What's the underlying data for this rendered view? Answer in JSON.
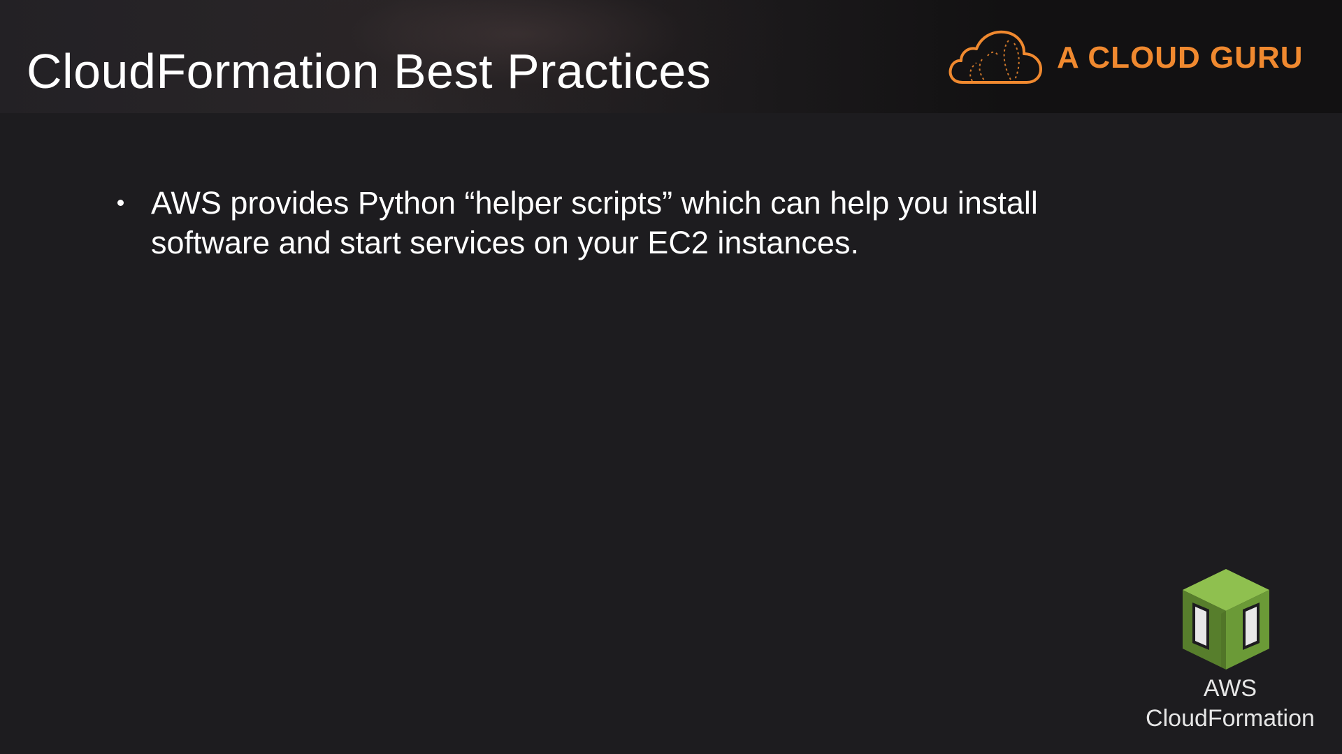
{
  "header": {
    "title": "CloudFormation Best Practices",
    "brand": {
      "name": "A CLOUD GURU",
      "logo_icon": "cloud-icon",
      "color": "#f0892f"
    }
  },
  "content": {
    "bullets": [
      {
        "text": "AWS provides Python “helper scripts” which can help you install software and start services on your EC2 instances."
      }
    ]
  },
  "service_badge": {
    "icon": "aws-cloudformation-icon",
    "color": "#6b9a37",
    "label_line1": "AWS",
    "label_line2": "CloudFormation"
  }
}
